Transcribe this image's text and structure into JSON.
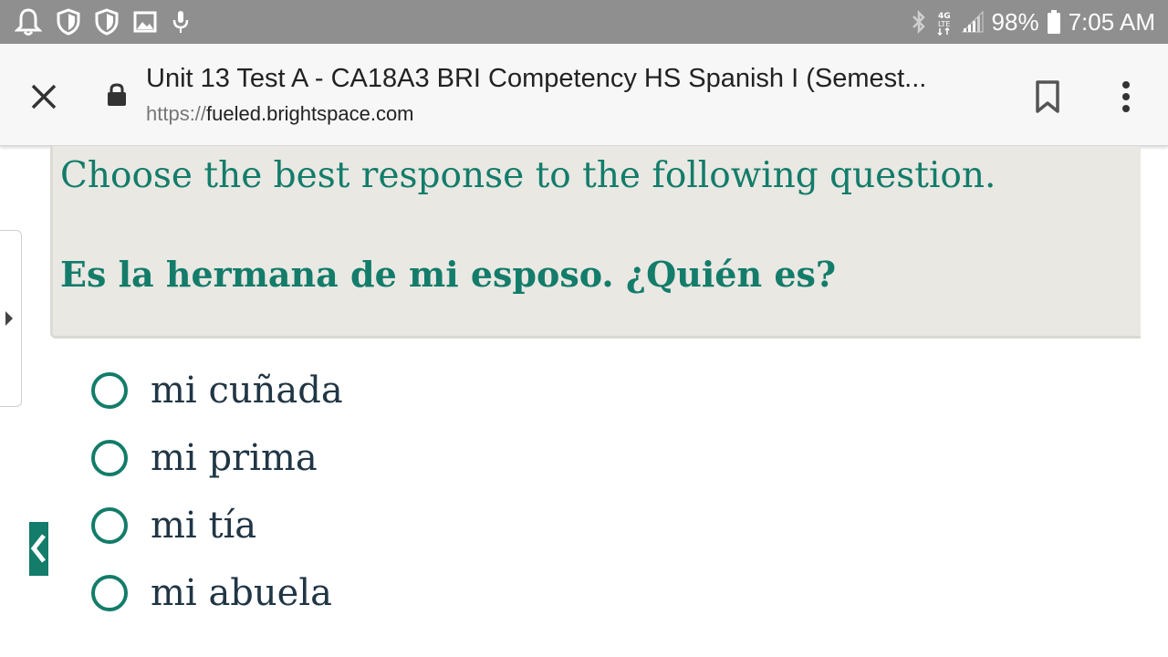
{
  "status_bar": {
    "battery_percent": "98%",
    "time": "7:05 AM",
    "left_icons": [
      "notification-bell-icon",
      "shield-icon",
      "shield-icon",
      "image-icon",
      "microphone-icon"
    ],
    "right_icons": [
      "bluetooth-icon",
      "4g-lte-icon",
      "signal-icon",
      "battery-icon"
    ]
  },
  "toolbar": {
    "title": "Unit 13 Test A - CA18A3 BRI Competency HS Spanish I (Semest...",
    "url_scheme": "https://",
    "url_host": "fueled.brightspace.com"
  },
  "question": {
    "instruction": "Choose the best response to the following question.",
    "prompt": "Es la hermana de mi esposo. ¿Quién es?"
  },
  "answers": [
    {
      "label": "mi cuñada"
    },
    {
      "label": "mi prima"
    },
    {
      "label": "mi tía"
    },
    {
      "label": "mi abuela"
    }
  ],
  "colors": {
    "accent": "#137c6a",
    "status_bar": "#8f8f8f",
    "panel": "#e9e8e3",
    "answer_text": "#213645"
  }
}
